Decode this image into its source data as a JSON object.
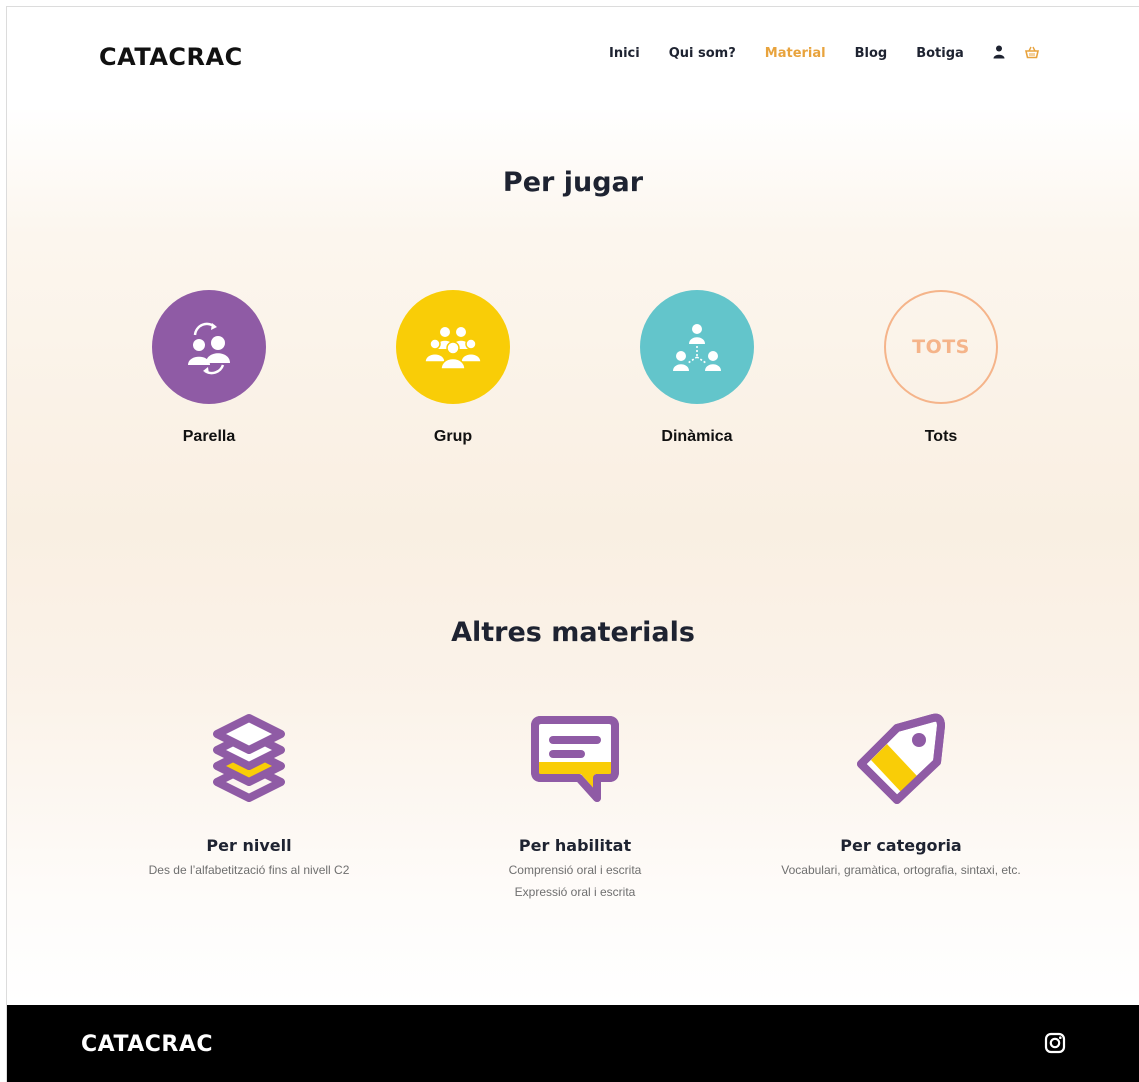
{
  "header": {
    "logo": "CATACRAC",
    "nav": [
      {
        "label": "Inici"
      },
      {
        "label": "Qui som?"
      },
      {
        "label": "Material",
        "active": true
      },
      {
        "label": "Blog"
      },
      {
        "label": "Botiga"
      }
    ],
    "icons": [
      "user-icon",
      "basket-icon"
    ]
  },
  "play": {
    "title": "Per jugar",
    "items": [
      {
        "label": "Parella",
        "icon": "pair-swap-icon",
        "color": "#8f5ba5"
      },
      {
        "label": "Grup",
        "icon": "group-icon",
        "color": "#f9cd07"
      },
      {
        "label": "Dinàmica",
        "icon": "dynamic-network-icon",
        "color": "#63c5cb"
      },
      {
        "label": "Tots",
        "badge": "TOTS",
        "color": "#f5b48a"
      }
    ]
  },
  "materials": {
    "title": "Altres materials",
    "items": [
      {
        "title": "Per nivell",
        "desc": [
          "Des de l’alfabetització fins al nivell C2"
        ],
        "icon": "layers-icon"
      },
      {
        "title": "Per habilitat",
        "desc": [
          "Comprensió oral i escrita",
          "Expressió oral i escrita"
        ],
        "icon": "speech-bubble-icon"
      },
      {
        "title": "Per categoria",
        "desc": [
          "Vocabulari, gramàtica, ortografia, sintaxi, etc."
        ],
        "icon": "tag-icon"
      }
    ],
    "colors": {
      "purple": "#8f5ba5",
      "yellow": "#f9cd07"
    }
  },
  "footer": {
    "logo": "CATACRAC",
    "icon": "instagram-icon"
  }
}
